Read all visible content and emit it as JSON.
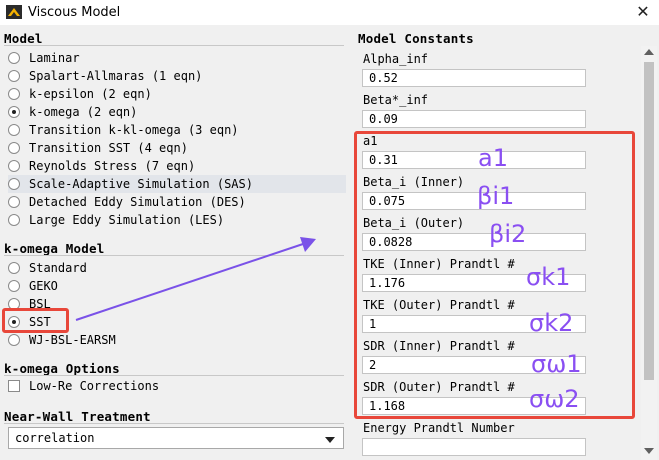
{
  "window": {
    "title": "Viscous Model",
    "icon": "ansys-logo-icon"
  },
  "model": {
    "heading": "Model",
    "options": [
      {
        "label": "Laminar",
        "selected": false
      },
      {
        "label": "Spalart-Allmaras (1 eqn)",
        "selected": false
      },
      {
        "label": "k-epsilon (2 eqn)",
        "selected": false
      },
      {
        "label": "k-omega (2 eqn)",
        "selected": true
      },
      {
        "label": "Transition k-kl-omega (3 eqn)",
        "selected": false
      },
      {
        "label": "Transition SST (4 eqn)",
        "selected": false
      },
      {
        "label": "Reynolds Stress (7 eqn)",
        "selected": false
      },
      {
        "label": "Scale-Adaptive Simulation (SAS)",
        "selected": false
      },
      {
        "label": "Detached Eddy Simulation (DES)",
        "selected": false
      },
      {
        "label": "Large Eddy Simulation (LES)",
        "selected": false
      }
    ]
  },
  "k_omega_model": {
    "heading": "k-omega Model",
    "options": [
      {
        "label": "Standard",
        "selected": false
      },
      {
        "label": "GEKO",
        "selected": false
      },
      {
        "label": "BSL",
        "selected": false
      },
      {
        "label": "SST",
        "selected": true
      },
      {
        "label": "WJ-BSL-EARSM",
        "selected": false
      }
    ]
  },
  "k_omega_options": {
    "heading": "k-omega Options",
    "low_re_corrections": {
      "label": "Low-Re Corrections",
      "checked": false
    }
  },
  "near_wall_treatment": {
    "heading": "Near-Wall Treatment",
    "selected": "correlation"
  },
  "model_constants": {
    "heading": "Model Constants",
    "items": [
      {
        "label": "Alpha_inf",
        "value": "0.52"
      },
      {
        "label": "Beta*_inf",
        "value": "0.09"
      },
      {
        "label": "a1",
        "value": "0.31"
      },
      {
        "label": "Beta_i (Inner)",
        "value": "0.075"
      },
      {
        "label": "Beta_i (Outer)",
        "value": "0.0828"
      },
      {
        "label": "TKE (Inner) Prandtl #",
        "value": "1.176"
      },
      {
        "label": "TKE (Outer) Prandtl #",
        "value": "1"
      },
      {
        "label": "SDR (Inner) Prandtl #",
        "value": "2"
      },
      {
        "label": "SDR (Outer) Prandtl #",
        "value": "1.168"
      },
      {
        "label": "Energy Prandtl Number",
        "value": ""
      }
    ]
  },
  "annotations": {
    "symbols": [
      "a1",
      "βi1",
      "βi2",
      "σk1",
      "σk2",
      "σω1",
      "σω2"
    ],
    "box_color": "#e8473a",
    "symbol_color": "#8a4ff2",
    "arrow_color": "#7a52e8"
  }
}
